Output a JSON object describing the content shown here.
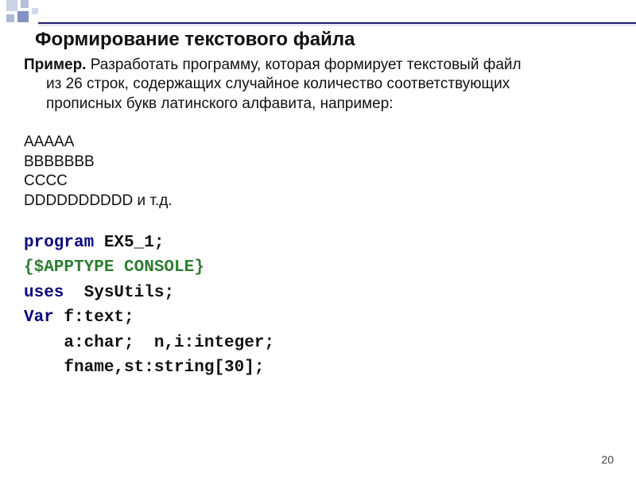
{
  "title": "Формирование текстового файла",
  "paragraph": {
    "label": "Пример.",
    "line1_rest": " Разработать программу, которая формирует текстовый файл",
    "line2": "из 26 строк, содержащих случайное количество соответствующих",
    "line3": "прописных букв латинского алфавита, например:"
  },
  "sample": [
    "AAAAA",
    "BBBBBBB",
    "CCCC",
    "DDDDDDDDDD и т.д."
  ],
  "code": {
    "l1_kw": "program",
    "l1_rest": " EX5_1;",
    "l2": "{$APPTYPE CONSOLE}",
    "l3_kw": "uses",
    "l3_rest": "  SysUtils;",
    "l4_kw": "Var",
    "l4_rest": " f:text;",
    "l5": "    a:char;  n,i:integer;",
    "l6": "    fname,st:string[30];"
  },
  "page_number": "20"
}
